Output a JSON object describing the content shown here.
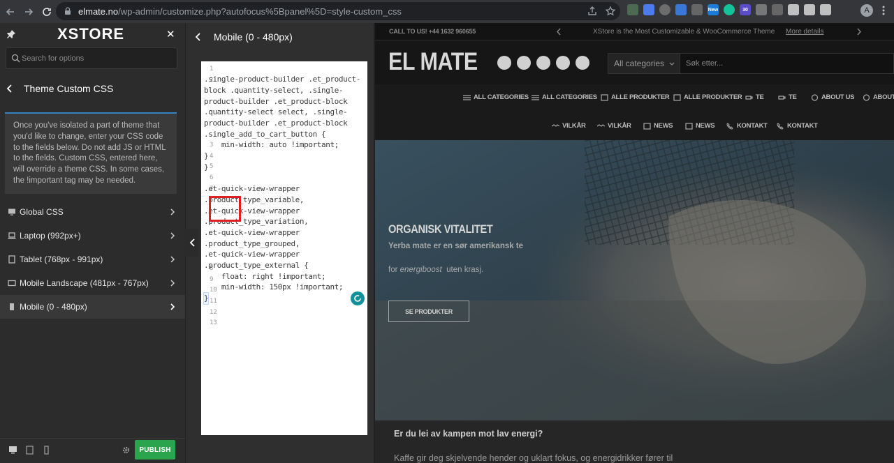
{
  "browser": {
    "url_domain": "elmate.no",
    "url_path": "/wp-admin/customize.php?autofocus%5Bpanel%5D=style-custom_css",
    "avatar_letter": "A",
    "ext_new_label": "New",
    "ext_count": "30"
  },
  "sidebar": {
    "logo": "XSTORE",
    "search_placeholder": "Search for options",
    "section_title": "Theme Custom CSS",
    "notice": "Once you've isolated a part of theme that you'd like to change, enter your CSS code to the fields below. Do not add JS or HTML to the fields. Custom CSS, entered here, will override a theme CSS. In some cases, the !important tag may be needed.",
    "devices": [
      {
        "label": "Global CSS",
        "icon": "monitor-icon"
      },
      {
        "label": "Laptop (992px+)",
        "icon": "laptop-icon"
      },
      {
        "label": "Tablet (768px - 991px)",
        "icon": "tablet-icon"
      },
      {
        "label": "Mobile Landscape (481px - 767px)",
        "icon": "mobile-landscape-icon"
      },
      {
        "label": "Mobile (0 - 480px)",
        "icon": "mobile-icon",
        "active": true
      }
    ],
    "publish_label": "PUBLISH"
  },
  "panel": {
    "title": "Mobile (0 - 480px)",
    "line_numbers": [
      "1",
      "2",
      "3",
      "4",
      "5",
      "6",
      "7",
      "8",
      "9",
      "10",
      "11",
      "12",
      "13"
    ],
    "code": [
      ".single-product-builder .et_product-",
      "block .quantity-select, .single-",
      "product-builder .et_product-block",
      ".quantity-select select, .single-",
      "product-builder .et_product-block",
      ".single_add_to_cart_button {",
      "    min-width: auto !important;",
      "}",
      "}",
      ".et-quick-view-wrapper",
      ".product_type_variable,",
      ".et-quick-view-wrapper",
      ".product_type_variation,",
      ".et-quick-view-wrapper",
      ".product_type_grouped,",
      ".et-quick-view-wrapper",
      ".product_type_external {",
      "    float: right !important;",
      "    min-width: 150px !important;",
      "}"
    ]
  },
  "site": {
    "call": "CALL TO US! +44 1632 960655",
    "promo": "XStore is the Most Customizable & WooCommerce Theme",
    "more": "More details",
    "logo": "EL MATE",
    "category_select": "All categories",
    "search_placeholder": "Søk etter...",
    "menu_row1": [
      "ALL CATEGORIES",
      "ALL CATEGORIES",
      "ALLE PRODUKTER",
      "ALLE PRODUKTER",
      "TE",
      "TE",
      "ABOUT US",
      "ABOUT U"
    ],
    "menu_row2": [
      "VILKÅR",
      "VILKÅR",
      "NEWS",
      "NEWS",
      "KONTAKT",
      "KONTAKT"
    ],
    "hero_title": "ORGANISK VITALITET",
    "hero_sub": "Yerba mate er en sør amerikansk te",
    "hero_sub2_pre": "for ",
    "hero_sub2_em": "energiboost",
    "hero_sub2_post": "  uten krasj.",
    "hero_button": "SE PRODUKTER",
    "question": "Er du lei av kampen mot lav energi?",
    "paragraph": "Kaffe gir deg skjelvende hender og uklart fokus, og energidrikker fører til"
  },
  "colors": {
    "publish": "#2aa54e",
    "accent_border": "#3582c4",
    "highlight_box": "#e02020"
  }
}
